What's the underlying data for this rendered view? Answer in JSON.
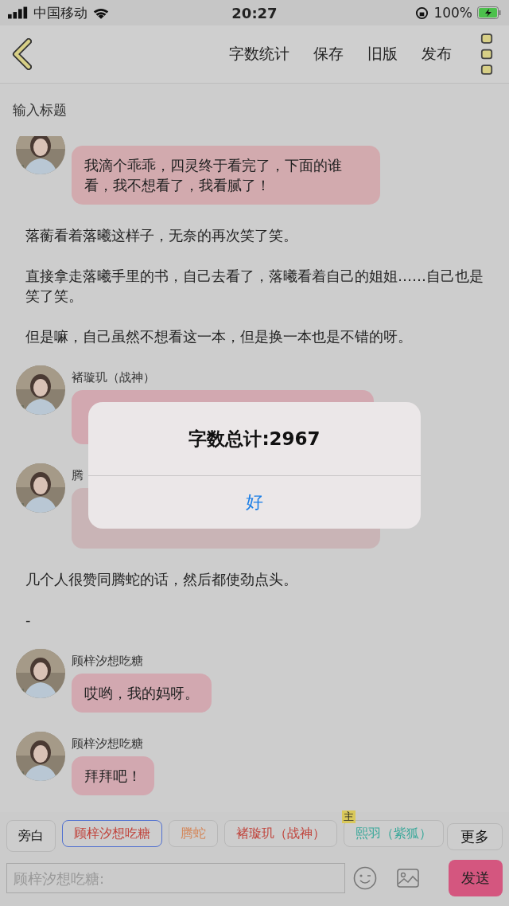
{
  "status_bar": {
    "carrier": "中国移动",
    "time": "20:27",
    "battery": "100%"
  },
  "nav": {
    "actions": [
      "字数统计",
      "保存",
      "旧版",
      "发布"
    ]
  },
  "title_field": {
    "placeholder": "输入标题"
  },
  "items": [
    {
      "kind": "message",
      "text": "我滴个乖乖，四灵终于看完了，下面的谁看，我不想看了，我看腻了！",
      "color": "#d2aaae"
    },
    {
      "kind": "narration",
      "text": "落蘅看着落曦这样子，无奈的再次笑了笑。"
    },
    {
      "kind": "narration",
      "text": "直接拿走落曦手里的书，自己去看了，落曦看着自己的姐姐……自己也是笑了笑。"
    },
    {
      "kind": "narration",
      "text": "但是嘛，自己虽然不想看这一本，但是换一本也是不错的呀。"
    },
    {
      "kind": "message",
      "name": "褚璇玑（战神）",
      "color": "#d2a8b0"
    },
    {
      "kind": "message",
      "name": "腾",
      "color": "#c9b4b6"
    },
    {
      "kind": "narration",
      "text": "几个人很赞同腾蛇的话，然后都使劲点头。"
    },
    {
      "kind": "narration",
      "text": "-"
    },
    {
      "kind": "message",
      "name": "顾梓汐想吃糖",
      "text": "哎哟，我的妈呀。",
      "color": "#d2a8b0"
    },
    {
      "kind": "message",
      "name": "顾梓汐想吃糖",
      "text": "拜拜吧！",
      "color": "#d2a8b0"
    }
  ],
  "alert": {
    "message": "字数总计:2967",
    "button": "好"
  },
  "roles": [
    {
      "label": "旁白",
      "selected": false,
      "color": "#111111"
    },
    {
      "label": "顾梓汐想吃糖",
      "selected": true,
      "color": "#c0443c"
    },
    {
      "label": "腾蛇",
      "selected": false,
      "color": "#d4875a"
    },
    {
      "label": "褚璇玑（战神）",
      "selected": false,
      "color": "#c0443c"
    },
    {
      "label": "熙羽（紫狐）",
      "selected": false,
      "color": "#3aa89a",
      "badge": "主"
    }
  ],
  "more_button": "更多",
  "input": {
    "placeholder": "顾梓汐想吃糖:"
  },
  "send_button": "发送"
}
